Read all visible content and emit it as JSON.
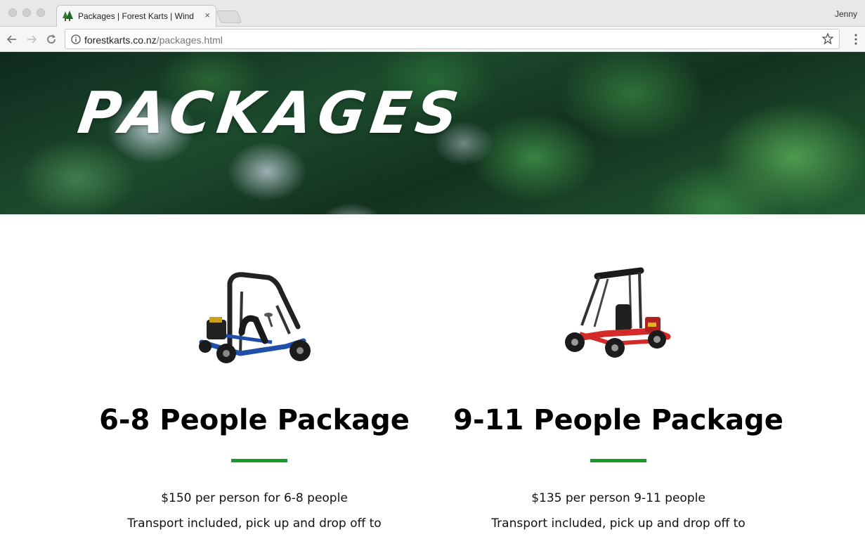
{
  "browser": {
    "tab_title": "Packages | Forest Karts | Wind",
    "tab_close": "×",
    "profile_name": "Jenny",
    "url_host": "forestkarts.co.nz",
    "url_path": "/packages.html"
  },
  "hero": {
    "title": "PACKAGES"
  },
  "packages": [
    {
      "title": "6-8 People Package",
      "price_line": "$150 per person for 6-8 people",
      "transport_line": "Transport included, pick up and drop off to",
      "kart_color": "blue"
    },
    {
      "title": "9-11 People Package",
      "price_line": "$135 per person 9-11 people",
      "transport_line": "Transport included, pick up and drop off to",
      "kart_color": "red"
    }
  ],
  "colors": {
    "accent": "#1a9a2c",
    "kart_blue": "#1f4fa8",
    "kart_red": "#d42a2a"
  }
}
